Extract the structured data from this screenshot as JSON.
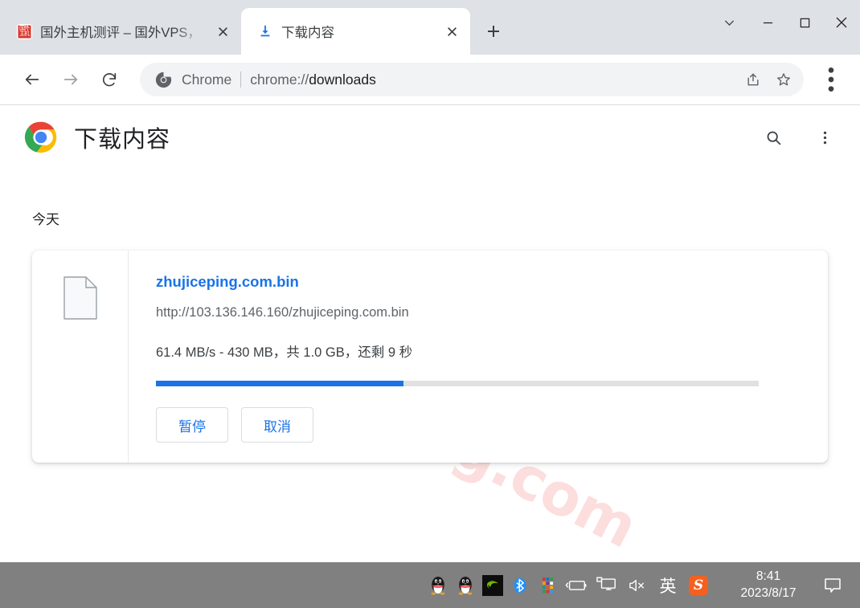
{
  "window": {
    "controls": {
      "tab_search": "tab-search",
      "minimize": "minimize",
      "maximize": "maximize",
      "close": "close"
    }
  },
  "tabs": [
    {
      "title": "国外主机测评 – 国外VPS，国",
      "favicon": "red-seal-favicon",
      "active": false,
      "close_label": "×"
    },
    {
      "title": "下载内容",
      "favicon": "download-icon",
      "active": true,
      "close_label": "×"
    }
  ],
  "new_tab_label": "+",
  "toolbar": {
    "back": "back-arrow",
    "forward": "forward-arrow",
    "reload": "reload",
    "omnibox": {
      "scheme_label": "Chrome",
      "url_protocol": "chrome://",
      "url_path": "downloads",
      "full_url": "chrome://downloads",
      "icon": "chrome-logo-grey"
    },
    "share_icon": "share-icon",
    "bookmark_icon": "star-icon",
    "menu_icon": "three-dot-menu"
  },
  "page": {
    "watermark": "zhujiceping.com",
    "title": "下载内容",
    "logo": "chrome-logo",
    "search_icon": "search-icon",
    "menu_icon": "three-dot-menu",
    "section_label": "今天",
    "download": {
      "file_icon": "generic-file-icon",
      "filename": "zhujiceping.com.bin",
      "url": "http://103.136.146.160/zhujiceping.com.bin",
      "status": "61.4 MB/s - 430 MB，共 1.0 GB，还剩 9 秒",
      "speed": "61.4 MB/s",
      "downloaded": "430 MB",
      "total": "1.0 GB",
      "remaining": "还剩 9 秒",
      "progress_percent": 41,
      "progress_color": "#1a73e8",
      "pause_label": "暂停",
      "cancel_label": "取消"
    }
  },
  "taskbar": {
    "tray_icons": [
      "qq-penguin-icon",
      "qq-penguin-icon",
      "nvidia-icon",
      "bluetooth-icon",
      "color-grid-icon",
      "battery-icon",
      "network-display-icon",
      "speaker-muted-icon"
    ],
    "ime_label": "英",
    "sogou_label": "S",
    "time": "8:41",
    "date": "2023/8/17",
    "notification_icon": "notification-bubble-icon"
  },
  "colors": {
    "accent_blue": "#1a73e8",
    "tabstrip_bg": "#dee1e6",
    "taskbar_bg": "#808080",
    "watermark_pink": "#fbdedd"
  }
}
